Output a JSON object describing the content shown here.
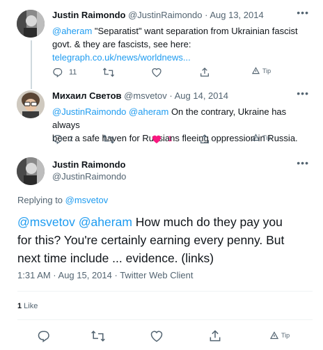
{
  "tweets": [
    {
      "name": "Justin Raimondo",
      "handle": "@JustinRaimondo",
      "date": "· Aug 13, 2014",
      "mention": "@aheram",
      "text_line1_rest": " \"Separatist\" want separation from Ukrainian fascist",
      "text_line2": "govt. & they are fascists, see here:",
      "link": "telegraph.co.uk/news/worldnews...",
      "reply_count": "11",
      "retweet_count": "",
      "like_count": "",
      "tip_label": "Tip"
    },
    {
      "name": "Михаил Светов",
      "handle": "@msvetov",
      "date": "· Aug 14, 2014",
      "mention1": "@JustinRaimondo",
      "mention2": "@aheram",
      "text_line1_rest": " On the contrary, Ukraine has always",
      "text_line2": "been a safe haven for Russians fleeing oppression in Russia.",
      "reply_count": "2",
      "retweet_count": "",
      "like_count": "1",
      "liked": true,
      "tip_label": "Tip"
    }
  ],
  "main_tweet": {
    "name": "Justin Raimondo",
    "handle": "@JustinRaimondo",
    "replying_prefix": "Replying to ",
    "replying_to": "@msvetov",
    "mention1": "@msvetov",
    "mention2": "@aheram",
    "line1_rest": " How much do they pay you",
    "line2": "for this? You're certainly earning every penny. But",
    "line3": "next time include ... evidence. (links)",
    "meta": "1:31 AM · Aug 15, 2014 · Twitter Web Client",
    "likes_count": "1",
    "likes_label": " Like",
    "tip_label": "Tip"
  },
  "icons": {
    "reply": "reply-icon",
    "retweet": "retweet-icon",
    "like": "heart-icon",
    "share": "share-icon",
    "tip": "tip-icon",
    "more": "more-icon"
  },
  "colors": {
    "link": "#1d9bf0",
    "muted": "#536471",
    "like": "#f91880",
    "text": "#0f1419"
  }
}
